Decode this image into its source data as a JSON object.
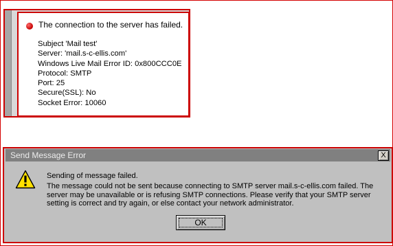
{
  "error_panel": {
    "headline": "The connection to the server has failed.",
    "details": [
      "Subject 'Mail test'",
      "Server: 'mail.s-c-ellis.com'",
      "Windows Live Mail Error ID: 0x800CCC0E",
      "Protocol: SMTP",
      "Port: 25",
      "Secure(SSL): No",
      "Socket Error: 10060"
    ],
    "status_color": "#c40000"
  },
  "dialog": {
    "title": "Send Message Error",
    "close_label": "X",
    "message_heading": "Sending of message failed.",
    "message_body": "The message could not be sent because connecting to SMTP server mail.s-c-ellis.com failed. The server may be unavailable or is refusing SMTP connections. Please verify that your SMTP server setting is correct and try again, or else contact your network administrator.",
    "ok_label": "OK",
    "icon": "warning-icon"
  },
  "colors": {
    "annotation_border": "#cc0000",
    "dialog_background": "#c0c0c0",
    "titlebar": "#808080"
  }
}
